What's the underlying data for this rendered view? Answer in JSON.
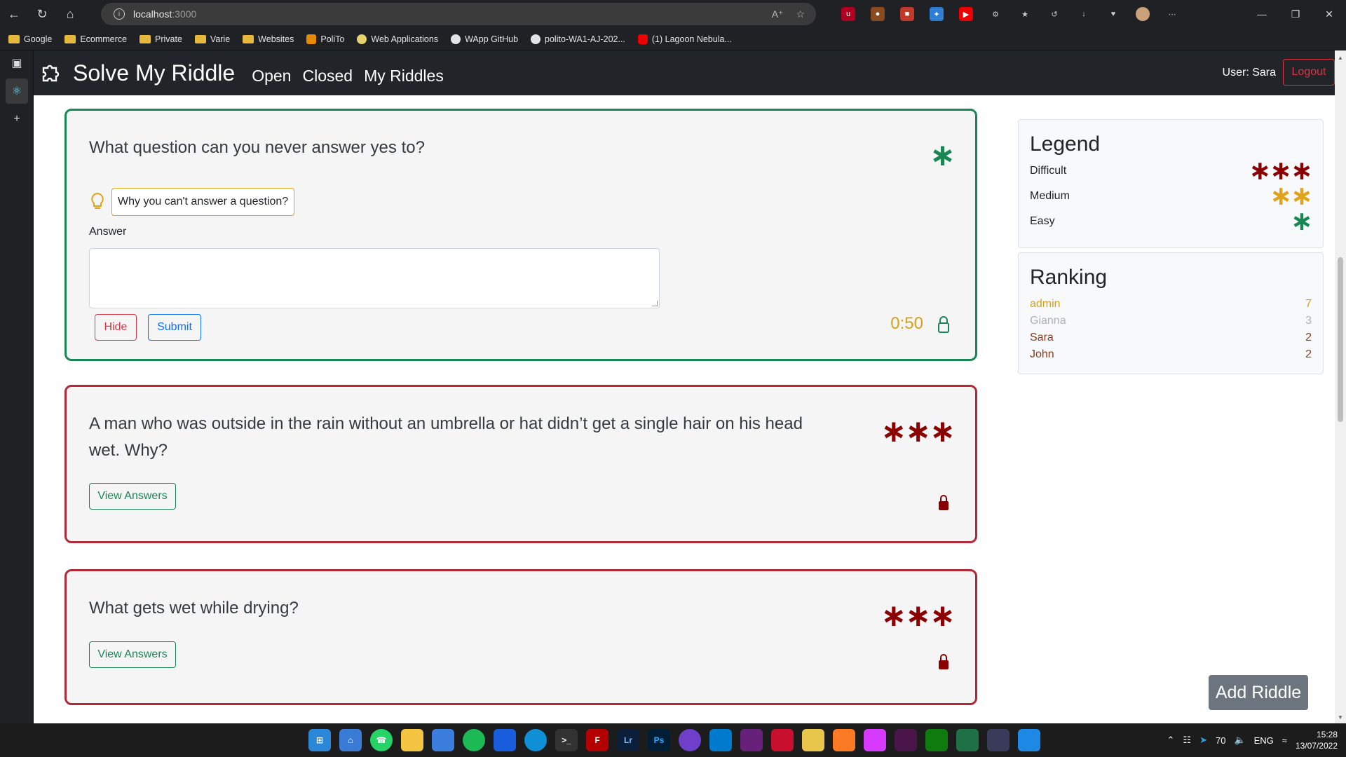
{
  "browser": {
    "url_host": "localhost",
    "url_port": ":3000",
    "bookmarks": [
      {
        "label": "Google",
        "type": "folder"
      },
      {
        "label": "Ecommerce",
        "type": "folder"
      },
      {
        "label": "Private",
        "type": "folder"
      },
      {
        "label": "Varie",
        "type": "folder"
      },
      {
        "label": "Websites",
        "type": "folder"
      },
      {
        "label": "PoliTo",
        "type": "site"
      },
      {
        "label": "Web Applications",
        "type": "site"
      },
      {
        "label": "WApp GitHub",
        "type": "github"
      },
      {
        "label": "polito-WA1-AJ-202...",
        "type": "github"
      },
      {
        "label": "(1) Lagoon Nebula...",
        "type": "youtube"
      }
    ]
  },
  "navbar": {
    "title": "Solve My Riddle",
    "links": [
      "Open",
      "Closed",
      "My Riddles"
    ],
    "user_text": "User: Sara",
    "logout_label": "Logout"
  },
  "riddles": [
    {
      "question": "What question can you never answer yes to?",
      "difficulty": "easy",
      "stars": "*",
      "hint": "Why you can't answer a question?",
      "answer_label": "Answer",
      "answer_value": "",
      "hide_label": "Hide",
      "submit_label": "Submit",
      "timer": "0:50",
      "status": "open"
    },
    {
      "question": "A man who was outside in the rain without an umbrella or hat didn’t get a single hair on his head wet. Why?",
      "difficulty": "hard",
      "stars": "***",
      "view_label": "View Answers",
      "status": "closed"
    },
    {
      "question": "What gets wet while drying?",
      "difficulty": "hard",
      "stars": "***",
      "view_label": "View Answers",
      "status": "closed"
    }
  ],
  "legend": {
    "title": "Legend",
    "items": [
      {
        "label": "Difficult",
        "stars": "***",
        "color": "#8b0000"
      },
      {
        "label": "Medium",
        "stars": "**",
        "color": "#e0a31a"
      },
      {
        "label": "Easy",
        "stars": "*",
        "color": "#198754"
      }
    ]
  },
  "ranking": {
    "title": "Ranking",
    "rows": [
      {
        "name": "admin",
        "score": "7",
        "color": "#d4a017"
      },
      {
        "name": "Gianna",
        "score": "3",
        "color": "#b0b0b0"
      },
      {
        "name": "Sara",
        "score": "2",
        "color": "#8b3a1a"
      },
      {
        "name": "John",
        "score": "2",
        "color": "#8b3a1a"
      }
    ]
  },
  "add_riddle_label": "Add Riddle",
  "colors": {
    "easy": "#198754",
    "hard": "#8b0000",
    "medium": "#e0a31a",
    "navbar": "#212529"
  },
  "taskbar": {
    "battery": "70",
    "lang": "ENG",
    "time": "15:28",
    "date": "13/07/2022"
  }
}
